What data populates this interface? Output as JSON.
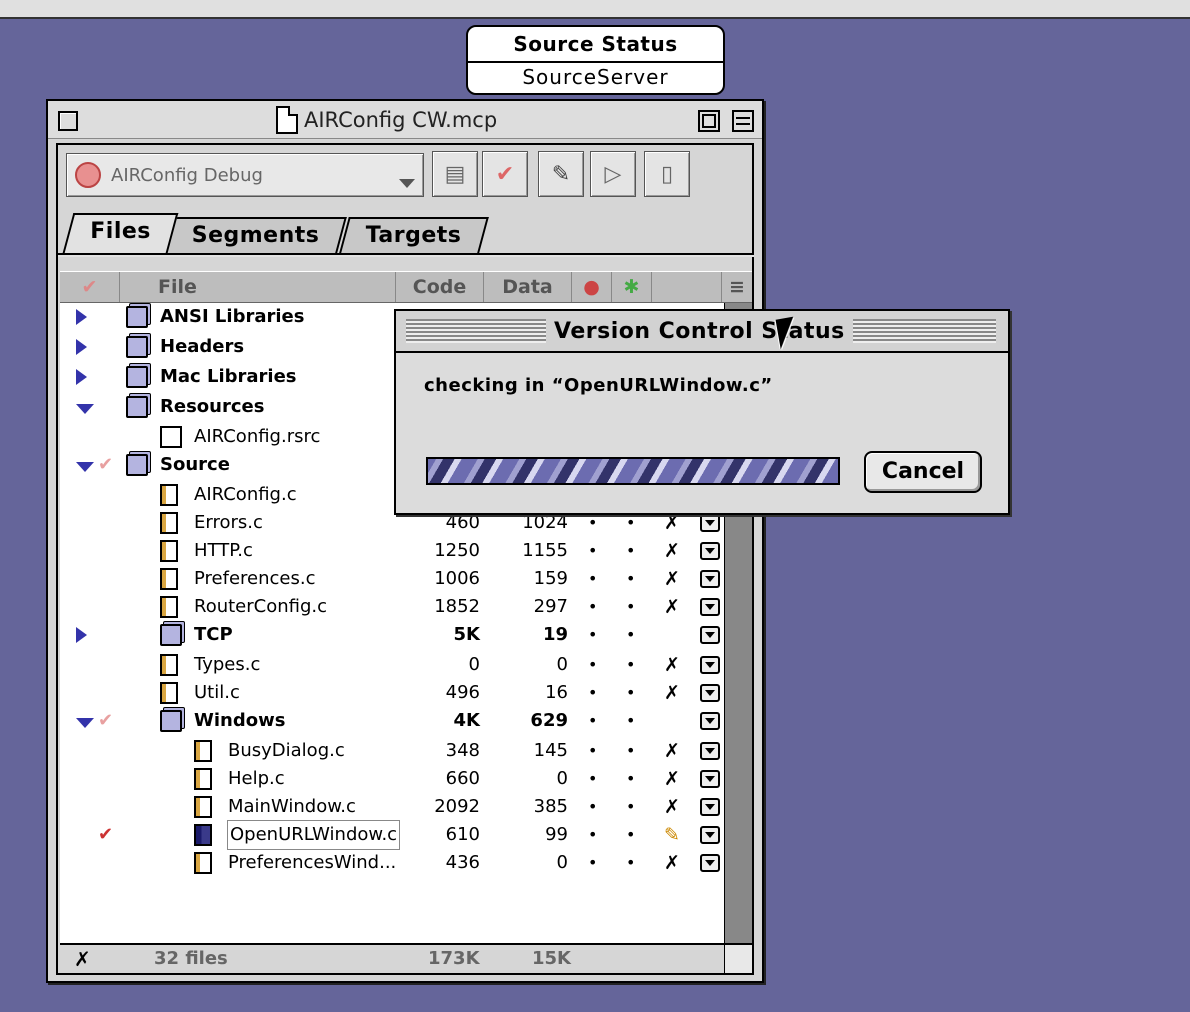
{
  "source_status": {
    "title": "Source Status",
    "subtitle": "SourceServer"
  },
  "project_window": {
    "title": "AIRConfig CW.mcp",
    "target": "AIRConfig Debug",
    "tabs": [
      "Files",
      "Segments",
      "Targets"
    ],
    "columns": {
      "file": "File",
      "code": "Code",
      "data": "Data"
    },
    "rows": [
      {
        "name": "ANSI Libraries",
        "type": "folder",
        "indent": 0,
        "expand": "closed",
        "bold": true,
        "code": "",
        "data": "",
        "check": ""
      },
      {
        "name": "Headers",
        "type": "folder",
        "indent": 0,
        "expand": "closed",
        "bold": true,
        "code": "",
        "data": "",
        "check": ""
      },
      {
        "name": "Mac Libraries",
        "type": "folder",
        "indent": 0,
        "expand": "closed",
        "bold": true,
        "code": "",
        "data": "",
        "check": ""
      },
      {
        "name": "Resources",
        "type": "folder",
        "indent": 0,
        "expand": "open",
        "bold": true,
        "code": "",
        "data": "",
        "check": ""
      },
      {
        "name": "AIRConfig.rsrc",
        "type": "rsrc",
        "indent": 1,
        "expand": "",
        "bold": false,
        "code": "",
        "data": "",
        "check": ""
      },
      {
        "name": "Source",
        "type": "folder",
        "indent": 0,
        "expand": "open",
        "bold": true,
        "code": "",
        "data": "",
        "check": "faint"
      },
      {
        "name": "AIRConfig.c",
        "type": "c",
        "indent": 1,
        "expand": "",
        "bold": false,
        "code": "",
        "data": "",
        "check": ""
      },
      {
        "name": "Errors.c",
        "type": "c",
        "indent": 1,
        "expand": "",
        "bold": false,
        "code": "460",
        "data": "1024",
        "check": "",
        "vc": "X"
      },
      {
        "name": "HTTP.c",
        "type": "c",
        "indent": 1,
        "expand": "",
        "bold": false,
        "code": "1250",
        "data": "1155",
        "check": "",
        "vc": "X"
      },
      {
        "name": "Preferences.c",
        "type": "c",
        "indent": 1,
        "expand": "",
        "bold": false,
        "code": "1006",
        "data": "159",
        "check": "",
        "vc": "X"
      },
      {
        "name": "RouterConfig.c",
        "type": "c",
        "indent": 1,
        "expand": "",
        "bold": false,
        "code": "1852",
        "data": "297",
        "check": "",
        "vc": "X"
      },
      {
        "name": "TCP",
        "type": "folder",
        "indent": 1,
        "expand": "closed",
        "bold": true,
        "code": "5K",
        "data": "19",
        "check": "",
        "vc": ""
      },
      {
        "name": "Types.c",
        "type": "c",
        "indent": 1,
        "expand": "",
        "bold": false,
        "code": "0",
        "data": "0",
        "check": "",
        "vc": "X"
      },
      {
        "name": "Util.c",
        "type": "c",
        "indent": 1,
        "expand": "",
        "bold": false,
        "code": "496",
        "data": "16",
        "check": "",
        "vc": "X"
      },
      {
        "name": "Windows",
        "type": "folder",
        "indent": 1,
        "expand": "open",
        "bold": true,
        "code": "4K",
        "data": "629",
        "check": "faint",
        "vc": ""
      },
      {
        "name": "BusyDialog.c",
        "type": "c",
        "indent": 2,
        "expand": "",
        "bold": false,
        "code": "348",
        "data": "145",
        "check": "",
        "vc": "X"
      },
      {
        "name": "Help.c",
        "type": "c",
        "indent": 2,
        "expand": "",
        "bold": false,
        "code": "660",
        "data": "0",
        "check": "",
        "vc": "X"
      },
      {
        "name": "MainWindow.c",
        "type": "c",
        "indent": 2,
        "expand": "",
        "bold": false,
        "code": "2092",
        "data": "385",
        "check": "",
        "vc": "X"
      },
      {
        "name": "OpenURLWindow.c",
        "type": "c-dark",
        "indent": 2,
        "expand": "",
        "bold": false,
        "code": "610",
        "data": "99",
        "check": "red",
        "vc": "pen",
        "selected": true
      },
      {
        "name": "PreferencesWind...",
        "type": "c",
        "indent": 2,
        "expand": "",
        "bold": false,
        "code": "436",
        "data": "0",
        "check": "",
        "vc": "X"
      }
    ],
    "footer": {
      "files": "32 files",
      "code_total": "173K",
      "data_total": "15K"
    }
  },
  "dialog": {
    "title": "Version Control Status",
    "message": "checking in “OpenURLWindow.c”",
    "cancel": "Cancel"
  }
}
